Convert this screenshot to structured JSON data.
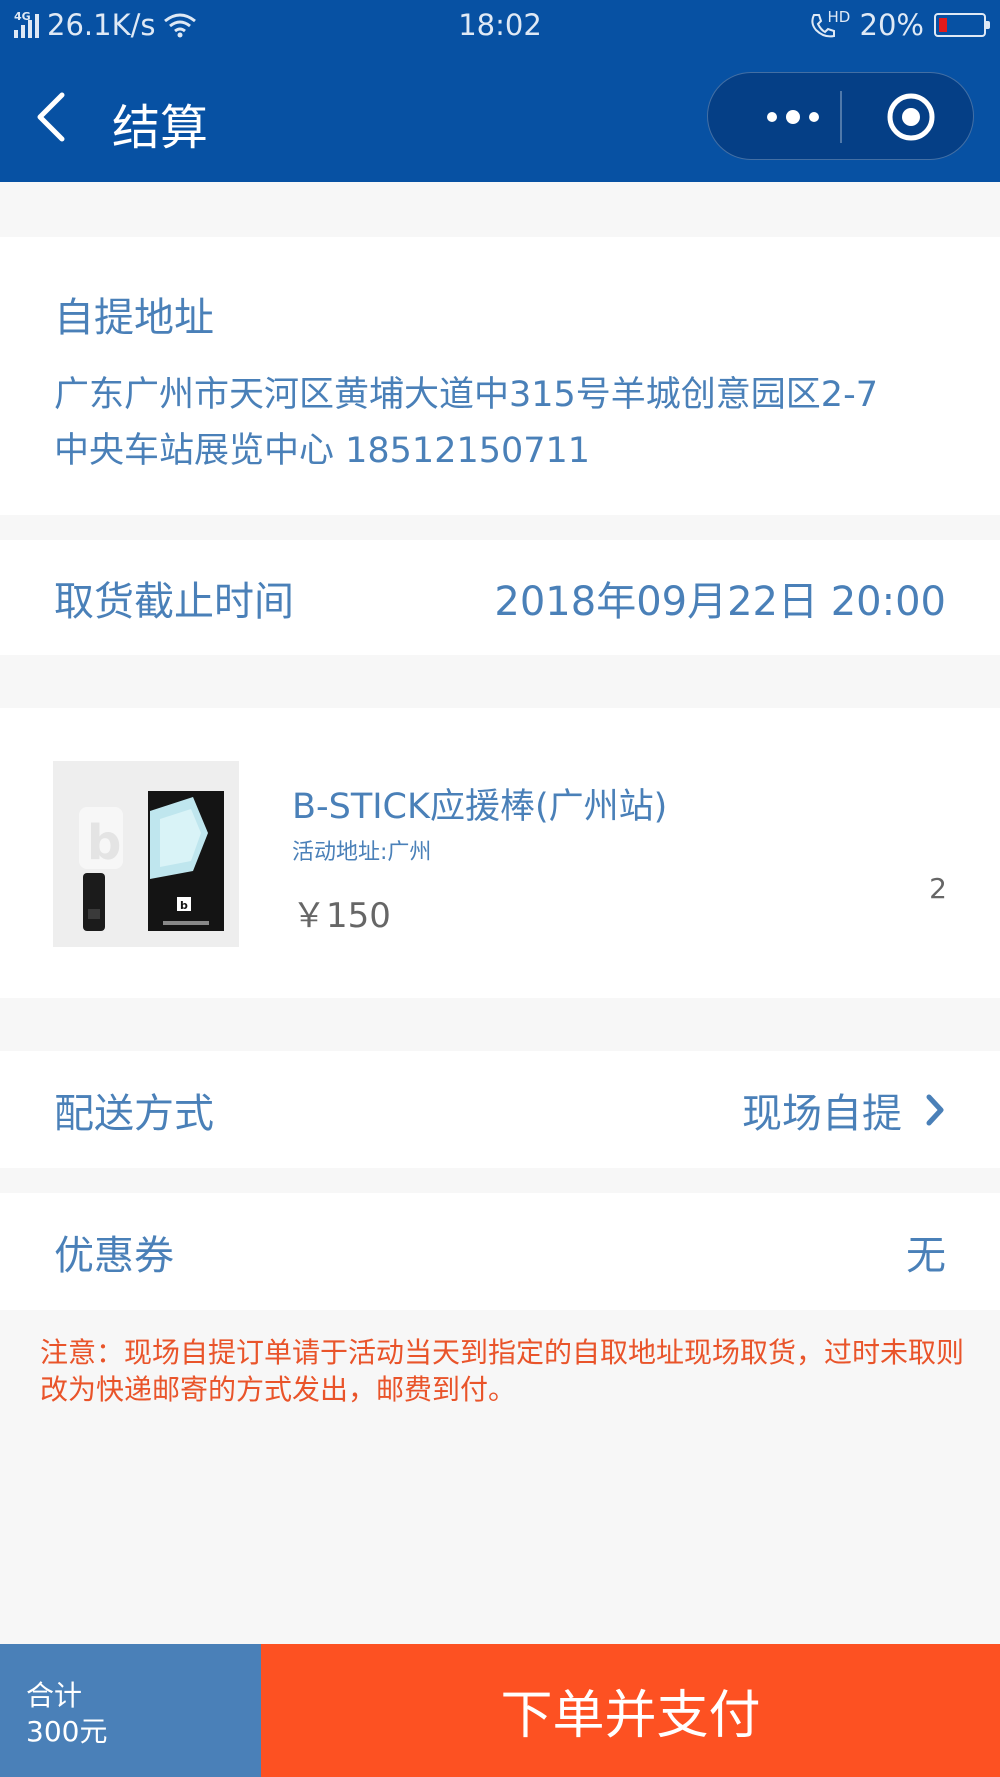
{
  "status_bar": {
    "network": "4G",
    "speed": "26.1K/s",
    "time": "18:02",
    "hd_label": "HD",
    "battery_text": "20%",
    "battery_level": 0.2,
    "battery_color": "#e21a1a"
  },
  "nav": {
    "title": "结算"
  },
  "address": {
    "title": "自提地址",
    "line1": "广东广州市天河区黄埔大道中315号羊城创意园区2-7",
    "line2": "中央车站展览中心 18512150711"
  },
  "deadline": {
    "label": "取货截止时间",
    "value": "2018年09月22日 20:00"
  },
  "product": {
    "name": "B-STICK应援棒(广州站)",
    "location": "活动地址:广州",
    "price": "￥150",
    "quantity": "2"
  },
  "delivery": {
    "label": "配送方式",
    "value": "现场自提"
  },
  "coupon": {
    "label": "优惠券",
    "value": "无"
  },
  "notice": "注意：现场自提订单请于活动当天到指定的自取地址现场取货，过时未取则改为快递邮寄的方式发出，邮费到付。",
  "footer": {
    "total_label": "合计",
    "total_amount": "300元",
    "pay_label": "下单并支付"
  },
  "colors": {
    "header": "#0751a3",
    "text_blue": "#4a80b8",
    "notice": "#e9542a",
    "pay_button": "#fd5122"
  }
}
